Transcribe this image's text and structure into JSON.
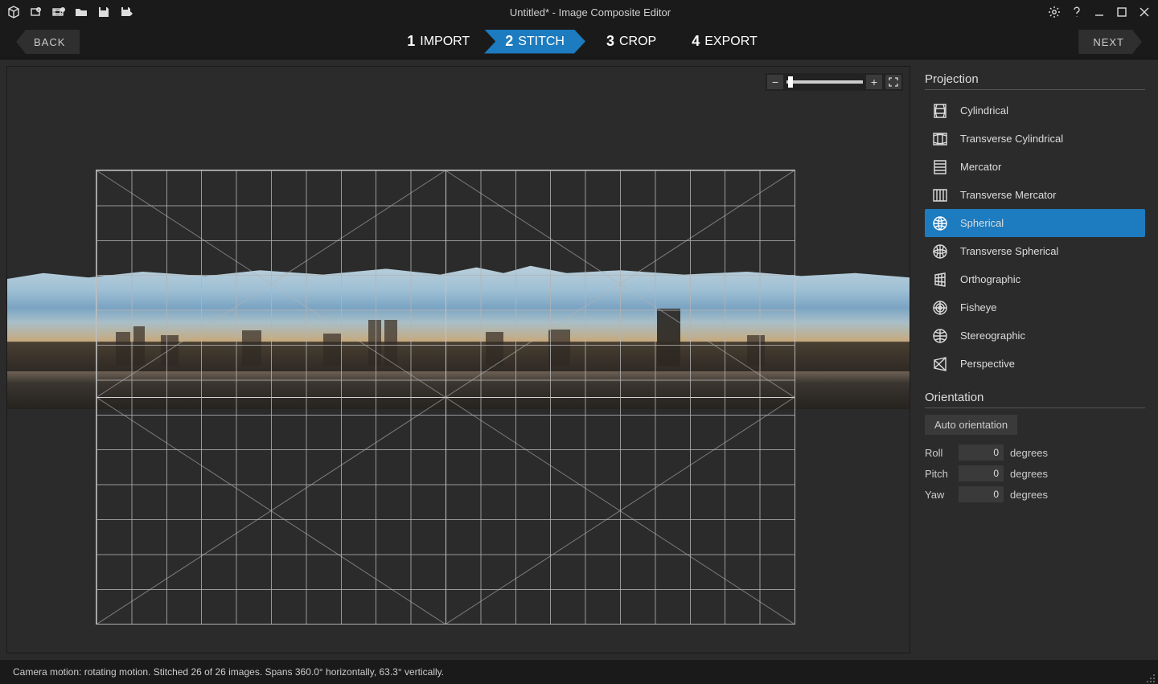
{
  "title": "Untitled* - Image Composite Editor",
  "nav": {
    "back": "BACK",
    "next": "NEXT"
  },
  "steps": [
    {
      "num": "1",
      "label": "IMPORT"
    },
    {
      "num": "2",
      "label": "STITCH"
    },
    {
      "num": "3",
      "label": "CROP"
    },
    {
      "num": "4",
      "label": "EXPORT"
    }
  ],
  "active_step_index": 1,
  "panels": {
    "projection": {
      "heading": "Projection",
      "items": [
        "Cylindrical",
        "Transverse Cylindrical",
        "Mercator",
        "Transverse Mercator",
        "Spherical",
        "Transverse Spherical",
        "Orthographic",
        "Fisheye",
        "Stereographic",
        "Perspective"
      ],
      "selected_index": 4
    },
    "orientation": {
      "heading": "Orientation",
      "auto_button": "Auto orientation",
      "rows": [
        {
          "label": "Roll",
          "value": "0",
          "unit": "degrees"
        },
        {
          "label": "Pitch",
          "value": "0",
          "unit": "degrees"
        },
        {
          "label": "Yaw",
          "value": "0",
          "unit": "degrees"
        }
      ]
    }
  },
  "status": "Camera motion: rotating motion. Stitched 26 of 26 images. Spans 360.0° horizontally, 63.3° vertically."
}
